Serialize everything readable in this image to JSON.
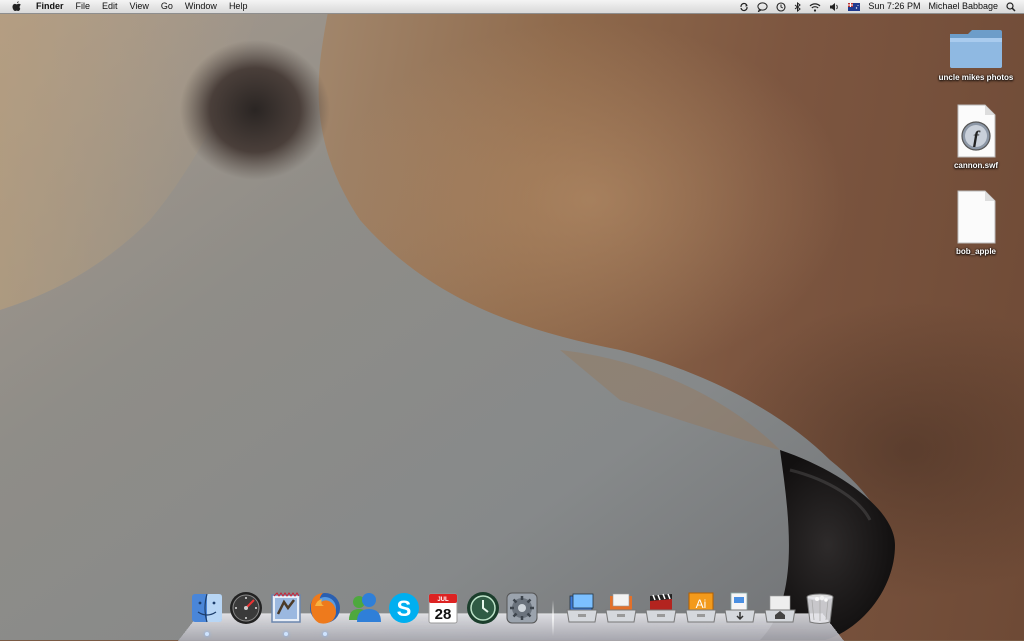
{
  "menubar": {
    "app_name": "Finder",
    "menus": [
      "File",
      "Edit",
      "View",
      "Go",
      "Window",
      "Help"
    ],
    "status_icons": [
      "sync-icon",
      "ichat-icon",
      "time-machine-icon",
      "bluetooth-icon",
      "wifi-icon",
      "volume-icon",
      "input-flag-icon"
    ],
    "clock": "Sun 7:26 PM",
    "user": "Michael Babbage"
  },
  "desktop": {
    "icons": [
      {
        "label": "uncle mikes photos",
        "kind": "folder"
      },
      {
        "label": "cannon.swf",
        "kind": "flash-file"
      },
      {
        "label": "bob_apple",
        "kind": "blank-file"
      }
    ]
  },
  "dock": {
    "apps": [
      {
        "name": "Finder",
        "icon": "finder-icon",
        "running": true
      },
      {
        "name": "Dashboard",
        "icon": "dashboard-icon",
        "running": false
      },
      {
        "name": "Mail",
        "icon": "mail-icon",
        "running": true
      },
      {
        "name": "Firefox",
        "icon": "firefox-icon",
        "running": true
      },
      {
        "name": "Messenger",
        "icon": "messenger-icon",
        "running": false
      },
      {
        "name": "Skype",
        "icon": "skype-icon",
        "running": false
      },
      {
        "name": "iCal",
        "icon": "calendar-icon",
        "running": false,
        "date": "28",
        "month": "JUL"
      },
      {
        "name": "Time Machine",
        "icon": "time-machine-icon",
        "running": false
      },
      {
        "name": "System Preferences",
        "icon": "system-preferences-icon",
        "running": false
      }
    ],
    "stacks": [
      {
        "name": "Applications",
        "icon": "applications-stack-icon"
      },
      {
        "name": "Documents",
        "icon": "documents-stack-icon"
      },
      {
        "name": "Movies",
        "icon": "movies-stack-icon"
      },
      {
        "name": "Illustrator",
        "icon": "illustrator-stack-icon",
        "text": "Ai"
      },
      {
        "name": "Downloads",
        "icon": "downloads-stack-icon"
      },
      {
        "name": "Home",
        "icon": "home-stack-icon"
      },
      {
        "name": "Trash",
        "icon": "trash-icon"
      }
    ]
  }
}
